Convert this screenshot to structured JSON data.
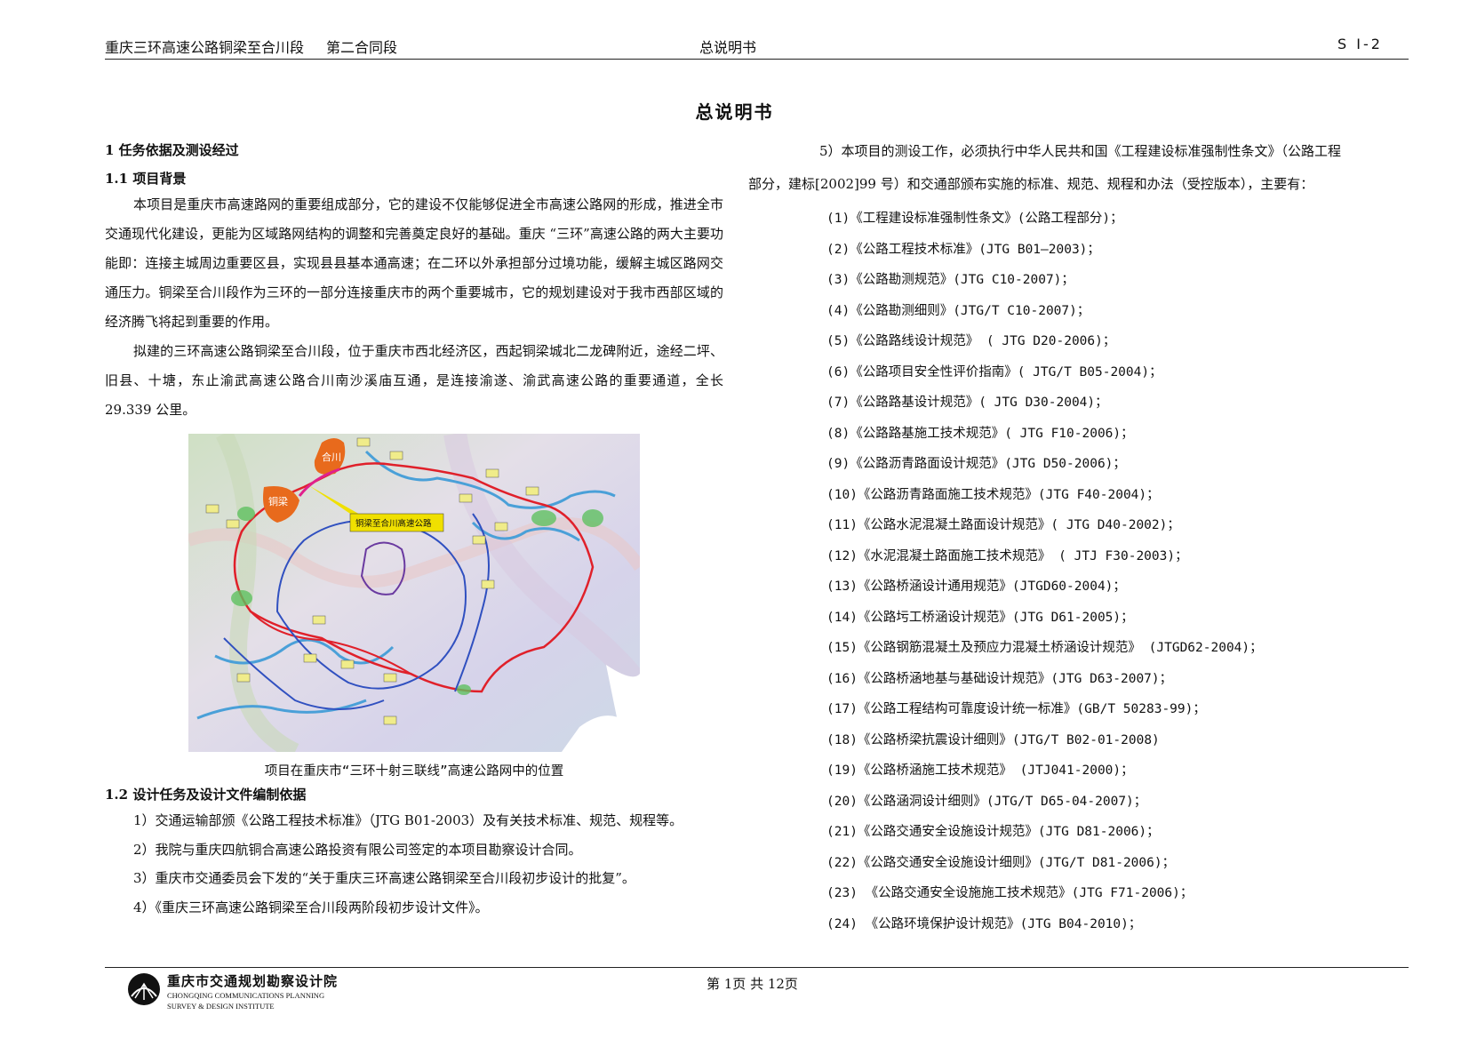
{
  "header": {
    "project": "重庆三环高速公路铜梁至合川段",
    "section": "第二合同段",
    "doc": "总说明书",
    "code": "S Ⅰ-2"
  },
  "title": "总说明书",
  "left": {
    "h1": "1 任务依据及测设经过",
    "h11": "1.1  项目背景",
    "p1": "本项目是重庆市高速路网的重要组成部分，它的建设不仅能够促进全市高速公路网的形成，推进全市交通现代化建设，更能为区域路网结构的调整和完善奠定良好的基础。重庆 “三环”高速公路的两大主要功能即：连接主城周边重要区县，实现县县基本通高速；在二环以外承担部分过境功能，缓解主城区路网交通压力。铜梁至合川段作为三环的一部分连接重庆市的两个重要城市，它的规划建设对于我市西部区域的经济腾飞将起到重要的作用。",
    "p2": "拟建的三环高速公路铜梁至合川段，位于重庆市西北经济区，西起铜梁城北二龙碑附近，途经二坪、旧县、十塘，东止渝武高速公路合川南沙溪庙互通，是连接渝遂、渝武高速公路的重要通道，全长 29.339 公里。",
    "map": {
      "callout": "铜梁至合川高速公路",
      "city_a": "合川",
      "city_b": "铜梁"
    },
    "caption": "项目在重庆市“三环十射三联线”高速公路网中的位置",
    "h12": "1.2 设计任务及设计文件编制依据",
    "basis": [
      "1）交通运输部颁《公路工程技术标准》（JTG B01-2003）及有关技术标准、规范、规程等。",
      "2）我院与重庆四航铜合高速公路投资有限公司签定的本项目勘察设计合同。",
      "3）重庆市交通委员会下发的“关于重庆三环高速公路铜梁至合川段初步设计的批复”。",
      "4）《重庆三环高速公路铜梁至合川段两阶段初步设计文件》。"
    ]
  },
  "right": {
    "intro_1": "5）本项目的测设工作，必须执行中华人民共和国《工程建设标准强制性条文》（公路工程",
    "intro_2": "部分，建标[2002]99 号）和交通部颁布实施的标准、规范、规程和办法（受控版本），主要有：",
    "standards": [
      "(1)《工程建设标准强制性条文》(公路工程部分)；",
      "(2)《公路工程技术标准》(JTG B01—2003)；",
      "(3)《公路勘测规范》(JTG C10-2007)；",
      "(4)《公路勘测细则》(JTG/T C10-2007)；",
      "(5)《公路路线设计规范》 ( JTG D20-2006)；",
      "(6)《公路项目安全性评价指南》( JTG/T B05-2004)；",
      "(7)《公路路基设计规范》( JTG D30-2004)；",
      "(8)《公路路基施工技术规范》( JTG F10-2006)；",
      "(9)《公路沥青路面设计规范》(JTG D50-2006)；",
      "(10)《公路沥青路面施工技术规范》(JTG F40-2004)；",
      "(11)《公路水泥混凝土路面设计规范》( JTG D40-2002)；",
      "(12)《水泥混凝土路面施工技术规范》 ( JTJ F30-2003)；",
      "(13)《公路桥涵设计通用规范》(JTGD60-2004)；",
      "(14)《公路圬工桥涵设计规范》(JTG D61-2005)；",
      "(15)《公路钢筋混凝土及预应力混凝土桥涵设计规范》 (JTGD62-2004)；",
      "(16)《公路桥涵地基与基础设计规范》(JTG D63-2007)；",
      "(17)《公路工程结构可靠度设计统一标准》(GB/T 50283-99)；",
      "(18)《公路桥梁抗震设计细则》(JTG/T B02-01-2008)",
      "(19)《公路桥涵施工技术规范》 (JTJ041-2000)；",
      "(20)《公路涵洞设计细则》(JTG/T D65-04-2007)；",
      "(21)《公路交通安全设施设计规范》(JTG D81-2006)；",
      "(22)《公路交通安全设施设计细则》(JTG/T D81-2006)；",
      "(23) 《公路交通安全设施施工技术规范》(JTG F71-2006)；",
      "(24) 《公路环境保护设计规范》(JTG B04-2010)；"
    ]
  },
  "footer": {
    "org_cn": "重庆市交通规划勘察设计院",
    "org_en_1": "CHONGQING COMMUNICATIONS PLANNING",
    "org_en_2": "SURVEY & DESIGN INSTITUTE",
    "page": "第 1页    共 12页"
  }
}
